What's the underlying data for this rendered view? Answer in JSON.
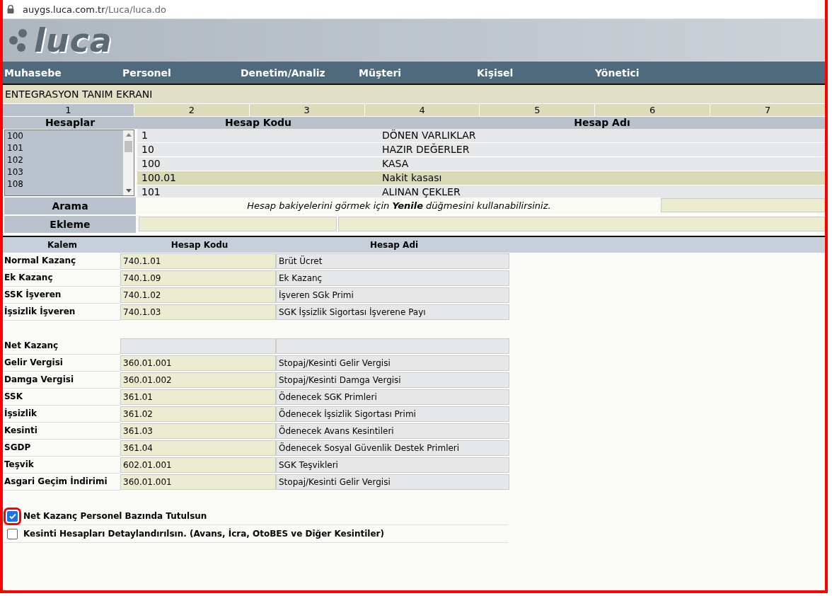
{
  "browser": {
    "url_host": "auygs.luca.com.tr",
    "url_path": "/Luca/luca.do"
  },
  "logo": {
    "text": "luca"
  },
  "menu": [
    "Muhasebe",
    "Personel",
    "Denetim/Analiz",
    "Müşteri",
    "Kişisel",
    "Yönetici"
  ],
  "page_title": "ENTEGRASYON TANIM EKRANI",
  "steps": [
    {
      "label": "1",
      "selected": true
    },
    {
      "label": "2",
      "selected": false
    },
    {
      "label": "3",
      "selected": false
    },
    {
      "label": "4",
      "selected": false
    },
    {
      "label": "5",
      "selected": false
    },
    {
      "label": "6",
      "selected": false
    },
    {
      "label": "7",
      "selected": false
    }
  ],
  "accounts": {
    "columns": [
      "Hesaplar",
      "Hesap Kodu",
      "Hesap Adı"
    ],
    "list": [
      "100",
      "101",
      "102",
      "103",
      "108"
    ],
    "rows": [
      {
        "code": "1",
        "name": "DÖNEN VARLIKLAR",
        "selected": false
      },
      {
        "code": "10",
        "name": "HAZIR DEĞERLER",
        "selected": false
      },
      {
        "code": "100",
        "name": "KASA",
        "selected": false
      },
      {
        "code": "100.01",
        "name": "Nakit kasası",
        "selected": true
      },
      {
        "code": "101",
        "name": "ALINAN ÇEKLER",
        "selected": false
      }
    ]
  },
  "search": {
    "label": "Arama",
    "hint": "Hesap bakiyelerini görmek için **Yenile** düğmesini kullanabilirsiniz."
  },
  "add": {
    "label": "Ekleme"
  },
  "mapping": {
    "columns": [
      "Kalem",
      "Hesap Kodu",
      "Hesap Adi"
    ],
    "groups": [
      [
        {
          "item": "Normal Kazanç",
          "code": "740.1.01",
          "name": "Brüt Ücret",
          "disabled": false
        },
        {
          "item": "Ek Kazanç",
          "code": "740.1.09",
          "name": "Ek Kazanç",
          "disabled": false
        },
        {
          "item": "SSK İşveren",
          "code": "740.1.02",
          "name": "İşveren SGk Primi",
          "disabled": false
        },
        {
          "item": "İşsizlik İşveren",
          "code": "740.1.03",
          "name": "SGK İşsizlik Sigortası İşverene Payı",
          "disabled": false
        }
      ],
      [
        {
          "item": "Net Kazanç",
          "disabled": true
        },
        {
          "item": "Gelir Vergisi",
          "code": "360.01.001",
          "name": "Stopaj/Kesinti Gelir Vergisi",
          "disabled": false
        },
        {
          "item": "Damga Vergisi",
          "code": "360.01.002",
          "name": "Stopaj/Kesinti Damga Vergisi",
          "disabled": false
        },
        {
          "item": "SSK",
          "code": "361.01",
          "name": "Ödenecek SGK Primleri",
          "disabled": false
        },
        {
          "item": "İşsizlik",
          "code": "361.02",
          "name": "Ödenecek İşsizlik Sigortası Primi",
          "disabled": false
        },
        {
          "item": "Kesinti",
          "code": "361.03",
          "name": "Ödenecek Avans Kesintileri",
          "disabled": false
        },
        {
          "item": "SGDP",
          "code": "361.04",
          "name": "Ödenecek Sosyal Güvenlik Destek Primleri",
          "disabled": false
        },
        {
          "item": "Teşvik",
          "code": "602.01.001",
          "name": "SGK Teşvikleri",
          "disabled": false
        },
        {
          "item": "Asgari Geçim İndirimi",
          "code": "360.01.001",
          "name": "Stopaj/Kesinti Gelir Vergisi",
          "disabled": false
        }
      ]
    ]
  },
  "options": [
    {
      "label": "Net Kazanç Personel Bazında Tutulsun",
      "checked": true
    },
    {
      "label": "Kesinti Hesapları Detaylandırılsın. (Avans, İcra, OtoBES ve Diğer Kesintiler)",
      "checked": false
    }
  ]
}
